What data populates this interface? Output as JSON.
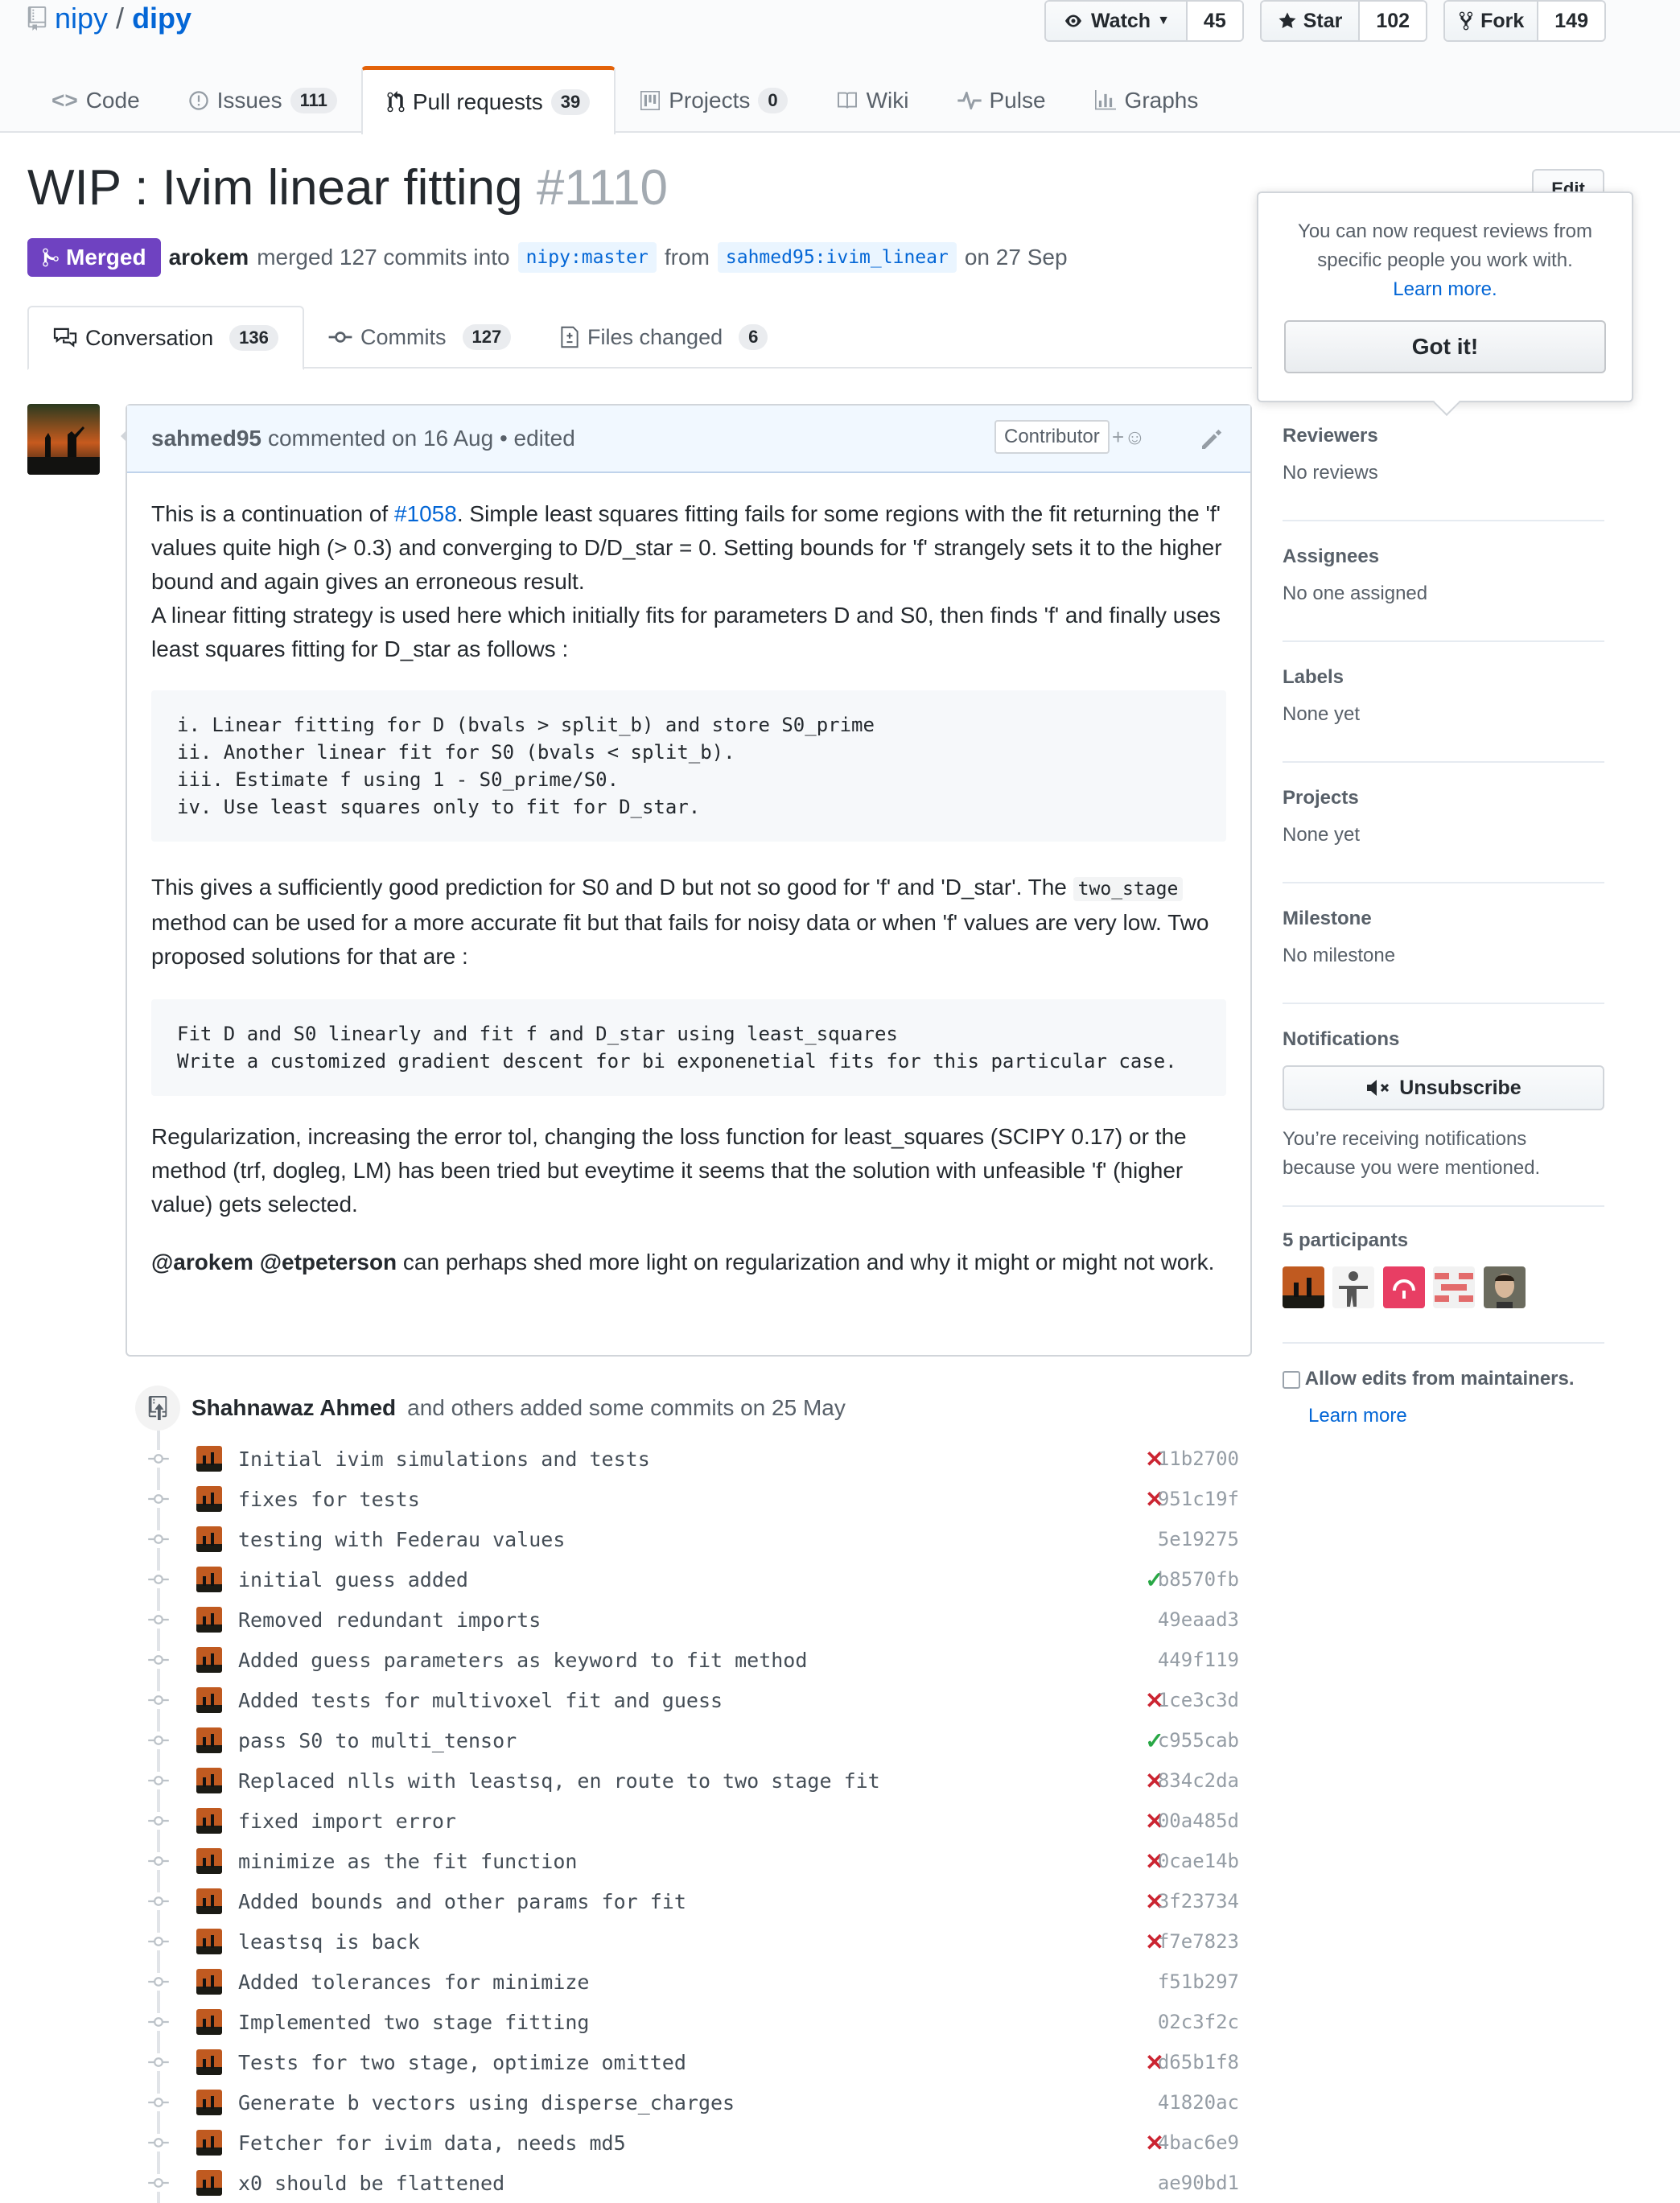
{
  "repo": {
    "owner": "nipy",
    "separator": "/",
    "name": "dipy"
  },
  "actions": {
    "watch_label": "Watch",
    "watch_count": "45",
    "star_label": "Star",
    "star_count": "102",
    "fork_label": "Fork",
    "fork_count": "149"
  },
  "tabs": [
    {
      "label": "Code",
      "count": ""
    },
    {
      "label": "Issues",
      "count": "111"
    },
    {
      "label": "Pull requests",
      "count": "39"
    },
    {
      "label": "Projects",
      "count": "0"
    },
    {
      "label": "Wiki",
      "count": ""
    },
    {
      "label": "Pulse",
      "count": ""
    },
    {
      "label": "Graphs",
      "count": ""
    }
  ],
  "pr": {
    "title": "WIP : Ivim linear fitting",
    "number": "#1110",
    "edit_label": "Edit",
    "state": "Merged",
    "author": "arokem",
    "merge_text": "merged 127 commits into",
    "base_branch": "nipy:master",
    "from_text": "from",
    "head_branch": "sahmed95:ivim_linear",
    "date_text": "on 27 Sep"
  },
  "subtabs": [
    {
      "label": "Conversation",
      "count": "136"
    },
    {
      "label": "Commits",
      "count": "127"
    },
    {
      "label": "Files changed",
      "count": "6"
    }
  ],
  "comment": {
    "author": "sahmed95",
    "header_text": "commented on 16 Aug",
    "edited_text": "• edited",
    "badge": "Contributor",
    "p1_pre": "This is a continuation of ",
    "p1_link": "#1058",
    "p1_post": ". Simple least squares fitting fails for some regions with the fit returning the 'f' values quite high (> 0.3) and converging to D/D_star = 0. Setting bounds for 'f' strangely sets it to the higher bound and again gives an erroneous result.",
    "p2": "A linear fitting strategy is used here which initially fits for parameters D and S0, then finds 'f' and finally uses least squares fitting for D_star as follows :",
    "code1": "i. Linear fitting for D (bvals > split_b) and store S0_prime\nii. Another linear fit for S0 (bvals < split_b).\niii. Estimate f using 1 - S0_prime/S0.\niv. Use least squares only to fit for D_star.",
    "p3_pre": "This gives a sufficiently good prediction for S0 and D but not so good for 'f' and 'D_star'. The ",
    "p3_code": "two_stage",
    "p3_post": " method can be used for a more accurate fit but that fails for noisy data or when 'f' values are very low. Two proposed solutions for that are :",
    "code2": "Fit D and S0 linearly and fit f and D_star using least_squares\nWrite a customized gradient descent for bi exponenetial fits for this particular case.",
    "p4": "Regularization, increasing the error tol, changing the loss function for least_squares (SCIPY 0.17) or the method (trf, dogleg, LM) has been tried but eveytime it seems that the solution with unfeasible 'f' (higher value) gets selected.",
    "mention1": "@arokem",
    "mention2": "@etpeterson",
    "p5_post": " can perhaps shed more light on regularization and why it might or might not work."
  },
  "timeline": {
    "author": "Shahnawaz Ahmed",
    "text": "and others added some commits on 25 May"
  },
  "commits": [
    {
      "msg": "Initial ivim simulations and tests",
      "status": "fail",
      "sha": "11b2700"
    },
    {
      "msg": "fixes for tests",
      "status": "fail",
      "sha": "951c19f"
    },
    {
      "msg": "testing with Federau values",
      "status": "none",
      "sha": "5e19275"
    },
    {
      "msg": "initial guess added",
      "status": "pass",
      "sha": "b8570fb"
    },
    {
      "msg": "Removed redundant imports",
      "status": "none",
      "sha": "49eaad3"
    },
    {
      "msg": "Added guess parameters as keyword to fit method",
      "status": "none",
      "sha": "449f119"
    },
    {
      "msg": "Added tests for multivoxel fit and guess",
      "status": "fail",
      "sha": "1ce3c3d"
    },
    {
      "msg": "pass S0 to multi_tensor",
      "status": "pass",
      "sha": "c955cab"
    },
    {
      "msg": "Replaced nlls with leastsq, en route to two stage fit",
      "status": "fail",
      "sha": "834c2da"
    },
    {
      "msg": "fixed import error",
      "status": "fail",
      "sha": "00a485d"
    },
    {
      "msg": "minimize as the fit function",
      "status": "fail",
      "sha": "0cae14b"
    },
    {
      "msg": "Added bounds and other params for fit",
      "status": "fail",
      "sha": "3f23734"
    },
    {
      "msg": "leastsq is back",
      "status": "fail",
      "sha": "f7e7823"
    },
    {
      "msg": "Added tolerances for minimize",
      "status": "none",
      "sha": "f51b297"
    },
    {
      "msg": "Implemented two stage fitting",
      "status": "none",
      "sha": "02c3f2c"
    },
    {
      "msg": "Tests for two stage, optimize omitted",
      "status": "fail",
      "sha": "d65b1f8"
    },
    {
      "msg": "Generate b vectors using disperse_charges",
      "status": "none",
      "sha": "41820ac"
    },
    {
      "msg": "Fetcher for ivim data, needs md5",
      "status": "fail",
      "sha": "4bac6e9"
    },
    {
      "msg": "x0 should be flattened",
      "status": "none",
      "sha": "ae90bd1"
    }
  ],
  "status_icons": {
    "fail": "✕",
    "pass": "✓",
    "none": ""
  },
  "colors": {
    "fail": "#cb2431",
    "pass": "#28a745",
    "merged": "#6f42c1",
    "link": "#0366d6"
  },
  "popover": {
    "text": "You can now request reviews from specific people you work with.",
    "link": "Learn more.",
    "button": "Got it!"
  },
  "sidebar": {
    "reviewers_title": "Reviewers",
    "reviewers_value": "No reviews",
    "assignees_title": "Assignees",
    "assignees_value": "No one assigned",
    "labels_title": "Labels",
    "labels_value": "None yet",
    "projects_title": "Projects",
    "projects_value": "None yet",
    "milestone_title": "Milestone",
    "milestone_value": "No milestone",
    "notifications_title": "Notifications",
    "unsubscribe_label": "Unsubscribe",
    "notifications_reason": "You’re receiving notifications because you were mentioned.",
    "participants_title": "5 participants",
    "allow_edits_label": "Allow edits from maintainers.",
    "learn_more": "Learn more"
  }
}
